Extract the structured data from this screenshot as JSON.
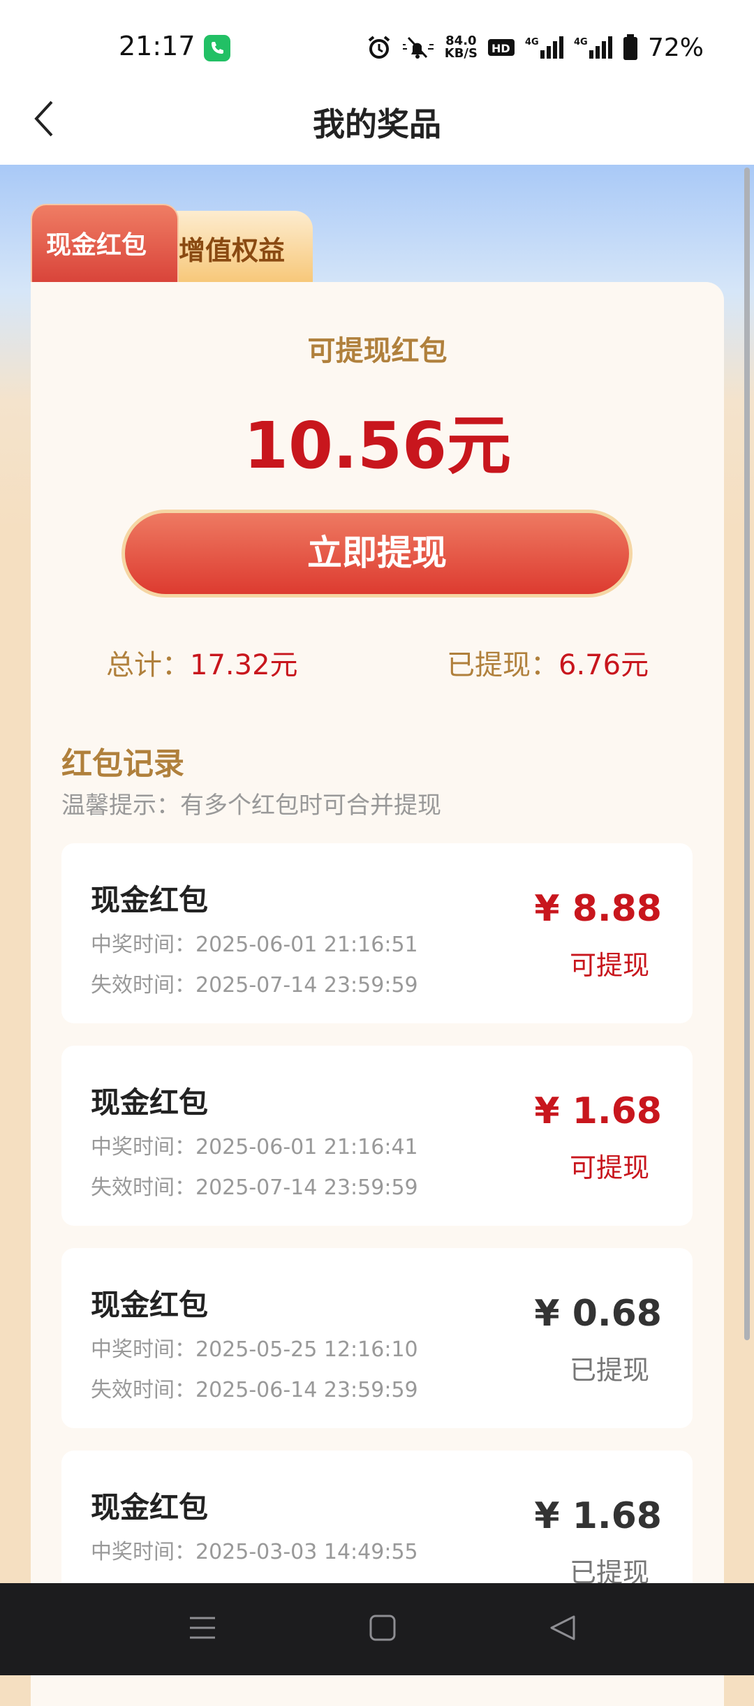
{
  "status_bar": {
    "time": "21:17",
    "net_speed_value": "84.0",
    "net_speed_unit": "KB/S",
    "battery": "72%"
  },
  "header": {
    "title": "我的奖品"
  },
  "tabs": [
    {
      "label": "现金红包",
      "active": true
    },
    {
      "label": "增值权益",
      "active": false
    }
  ],
  "summary": {
    "withdrawable_label": "可提现红包",
    "withdrawable_amount": "10.56元",
    "withdraw_button": "立即提现",
    "total_label": "总计：",
    "total_value": "17.32元",
    "withdrawn_label": "已提现：",
    "withdrawn_value": "6.76元"
  },
  "records": {
    "title": "红包记录",
    "tip": "温馨提示：有多个红包时可合并提现",
    "items": [
      {
        "name": "现金红包",
        "win_time": "中奖时间：2025-06-01 21:16:51",
        "expire_time": "失效时间：2025-07-14 23:59:59",
        "amount": "¥ 8.88",
        "status": "可提现"
      },
      {
        "name": "现金红包",
        "win_time": "中奖时间：2025-06-01 21:16:41",
        "expire_time": "失效时间：2025-07-14 23:59:59",
        "amount": "¥ 1.68",
        "status": "可提现"
      },
      {
        "name": "现金红包",
        "win_time": "中奖时间：2025-05-25 12:16:10",
        "expire_time": "失效时间：2025-06-14 23:59:59",
        "amount": "¥ 0.68",
        "status": "已提现"
      },
      {
        "name": "现金红包",
        "win_time": "中奖时间：2025-03-03 14:49:55",
        "amount": "¥ 1.68",
        "status": "已提现"
      }
    ]
  },
  "colors": {
    "accent_red": "#c8161d",
    "gold_text": "#b0803c",
    "button_red": "#dd3b30"
  },
  "icons": [
    "phone-icon",
    "alarm-icon",
    "mute-icon",
    "hd-icon",
    "signal-4g-icon",
    "battery-icon",
    "back-chevron-icon",
    "menu-icon",
    "home-icon",
    "back-triangle-icon"
  ]
}
